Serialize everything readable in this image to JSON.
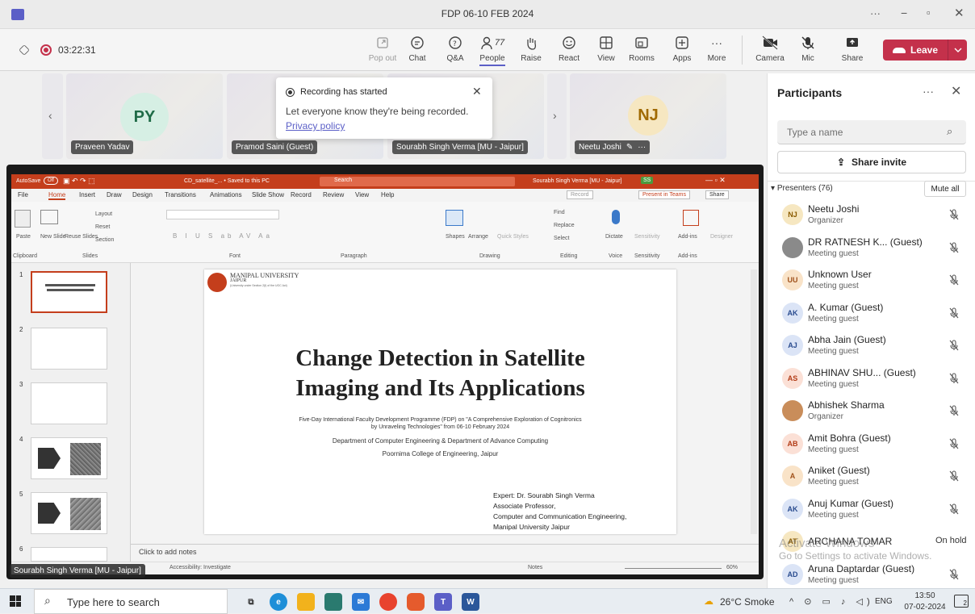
{
  "window": {
    "title": "FDP 06-10 FEB 2024",
    "more": "···"
  },
  "toolbar": {
    "timer": "03:22:31",
    "popout": "Pop out",
    "chat": "Chat",
    "qa": "Q&A",
    "people": "People",
    "people_count": "77",
    "raise": "Raise",
    "react": "React",
    "view": "View",
    "rooms": "Rooms",
    "apps": "Apps",
    "more": "More",
    "camera": "Camera",
    "mic": "Mic",
    "share": "Share",
    "leave": "Leave"
  },
  "video_strip": {
    "tiles": [
      {
        "initials": "PY",
        "name": "Praveen Yadav"
      },
      {
        "initials": "",
        "name": "Pramod Saini (Guest)"
      },
      {
        "initials": "",
        "name": "Sourabh Singh Verma [MU - Jaipur]"
      },
      {
        "initials": "NJ",
        "name": "Neetu Joshi"
      }
    ],
    "more_dots": "···"
  },
  "recording_toast": {
    "title": "Recording has started",
    "message": "Let everyone know they're being recorded.",
    "link": "Privacy policy"
  },
  "ppt": {
    "autosave": "AutoSave",
    "autosave_state": "Off",
    "filename": "CD_satellite_... • Saved to this PC",
    "search": "Search",
    "user": "Sourabh Singh Verma [MU - Jaipur]",
    "user_initials": "SS",
    "menu": [
      "File",
      "Home",
      "Insert",
      "Draw",
      "Design",
      "Transitions",
      "Animations",
      "Slide Show",
      "Record",
      "Review",
      "View",
      "Help"
    ],
    "record_btn": "Record",
    "present_btn": "Present in Teams",
    "share_btn": "Share",
    "ribbon": {
      "paste": "Paste",
      "new_slide": "New Slide",
      "reuse": "Reuse Slides",
      "layout": "Layout",
      "reset": "Reset",
      "section": "Section",
      "clipboard": "Clipboard",
      "slides": "Slides",
      "font": "Font",
      "paragraph": "Paragraph",
      "shapes": "Shapes",
      "arrange": "Arrange",
      "quick": "Quick Styles",
      "drawing": "Drawing",
      "find": "Find",
      "replace": "Replace",
      "select": "Select",
      "editing": "Editing",
      "dictate": "Dictate",
      "voice": "Voice",
      "sensitivity": "Sensitivity",
      "addins": "Add-ins",
      "designer": "Designer"
    },
    "thumb_numbers": [
      "1",
      "2",
      "3",
      "4",
      "5",
      "6"
    ],
    "slide": {
      "uni_name": "MANIPAL UNIVERSITY",
      "uni_city": "JAIPUR",
      "uni_sub": "(University under Section 2(f) of the UGC Act)",
      "title_line1": "Change Detection in Satellite",
      "title_line2": "Imaging and Its Applications",
      "line1": "Five-Day International Faculty Development Programme (FDP) on \"A Comprehensive Exploration of Cognitronics",
      "line2": "by Unraveling Technologies\" from 06-10 February 2024",
      "line3": "Department of Computer Engineering & Department of Advance Computing",
      "line4": "Poornima College of Engineering, Jaipur",
      "expert": [
        "Expert: Dr. Sourabh Singh Verma",
        "Associate Professor,",
        "Computer and Communication Engineering,",
        "Manipal University Jaipur"
      ]
    },
    "notes": "Click to add notes",
    "status_left": "Accessibility: Investigate",
    "status_notes": "Notes",
    "zoom": "60%"
  },
  "presenter_tag": "Sourabh Singh Verma [MU - Jaipur]",
  "panel": {
    "title": "Participants",
    "search_placeholder": "Type a name",
    "share_invite": "Share invite",
    "section": "Presenters (76)",
    "mute_all": "Mute all",
    "people": [
      {
        "initials": "NJ",
        "name": "Neetu Joshi",
        "role": "Organizer",
        "color": "#f6e7c1",
        "fg": "#8a5b00"
      },
      {
        "initials": "",
        "name": "DR RATNESH K... (Guest)",
        "role": "Meeting guest",
        "color": "#8a8a8a",
        "fg": "#ffffff"
      },
      {
        "initials": "UU",
        "name": "Unknown User",
        "role": "Meeting guest",
        "color": "#f9e3c8",
        "fg": "#a0521c"
      },
      {
        "initials": "AK",
        "name": "A. Kumar (Guest)",
        "role": "Meeting guest",
        "color": "#dbe4f6",
        "fg": "#2a4c8f"
      },
      {
        "initials": "AJ",
        "name": "Abha Jain (Guest)",
        "role": "Meeting guest",
        "color": "#dbe4f6",
        "fg": "#2a4c8f"
      },
      {
        "initials": "AS",
        "name": "ABHINAV SHU... (Guest)",
        "role": "Meeting guest",
        "color": "#fbe0d6",
        "fg": "#b23c17"
      },
      {
        "initials": "",
        "name": "Abhishek Sharma",
        "role": "Organizer",
        "color": "#c98d5a",
        "fg": "#ffffff"
      },
      {
        "initials": "AB",
        "name": "Amit Bohra (Guest)",
        "role": "Meeting guest",
        "color": "#fbe0d6",
        "fg": "#b23c17"
      },
      {
        "initials": "A",
        "name": "Aniket (Guest)",
        "role": "Meeting guest",
        "color": "#f9e3c8",
        "fg": "#a0521c"
      },
      {
        "initials": "AK",
        "name": "Anuj Kumar (Guest)",
        "role": "Meeting guest",
        "color": "#dbe4f6",
        "fg": "#2a4c8f"
      },
      {
        "initials": "AT",
        "name": "ARCHANA TOMAR",
        "role": "",
        "status": "On hold",
        "color": "#f6e7c1",
        "fg": "#8a5b00"
      },
      {
        "initials": "AD",
        "name": "Aruna Daptardar (Guest)",
        "role": "Meeting guest",
        "color": "#dbe4f6",
        "fg": "#2a4c8f"
      }
    ],
    "watermark1": "Activate Windows",
    "watermark2": "Go to Settings to activate Windows."
  },
  "taskbar": {
    "search": "Type here to search",
    "weather": "26°C Smoke",
    "lang": "ENG",
    "time": "13:50",
    "date": "07-02-2024",
    "notif": "2"
  }
}
